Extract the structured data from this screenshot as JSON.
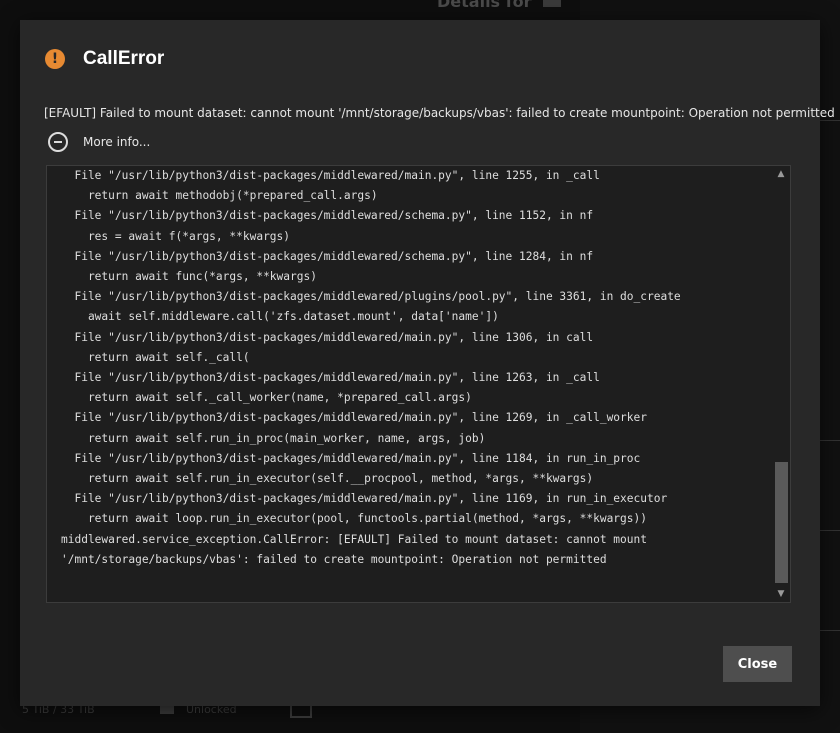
{
  "background": {
    "title": "Details for",
    "footer_size": "5 TiB / 33 TiB",
    "footer_status": "Unlocked"
  },
  "dialog": {
    "icon": "warning-circle-icon",
    "title": "CallError",
    "message": "[EFAULT] Failed to mount dataset: cannot mount '/mnt/storage/backups/vbas': failed to create mountpoint: Operation not permitted",
    "more_info_label": "More info...",
    "traceback": "  File \"/usr/lib/python3/dist-packages/middlewared/main.py\", line 1255, in _call\n    return await methodobj(*prepared_call.args)\n  File \"/usr/lib/python3/dist-packages/middlewared/schema.py\", line 1152, in nf\n    res = await f(*args, **kwargs)\n  File \"/usr/lib/python3/dist-packages/middlewared/schema.py\", line 1284, in nf\n    return await func(*args, **kwargs)\n  File \"/usr/lib/python3/dist-packages/middlewared/plugins/pool.py\", line 3361, in do_create\n    await self.middleware.call('zfs.dataset.mount', data['name'])\n  File \"/usr/lib/python3/dist-packages/middlewared/main.py\", line 1306, in call\n    return await self._call(\n  File \"/usr/lib/python3/dist-packages/middlewared/main.py\", line 1263, in _call\n    return await self._call_worker(name, *prepared_call.args)\n  File \"/usr/lib/python3/dist-packages/middlewared/main.py\", line 1269, in _call_worker\n    return await self.run_in_proc(main_worker, name, args, job)\n  File \"/usr/lib/python3/dist-packages/middlewared/main.py\", line 1184, in run_in_proc\n    return await self.run_in_executor(self.__procpool, method, *args, **kwargs)\n  File \"/usr/lib/python3/dist-packages/middlewared/main.py\", line 1169, in run_in_executor\n    return await loop.run_in_executor(pool, functools.partial(method, *args, **kwargs))\nmiddlewared.service_exception.CallError: [EFAULT] Failed to mount dataset: cannot mount\n'/mnt/storage/backups/vbas': failed to create mountpoint: Operation not permitted",
    "close_label": "Close",
    "colors": {
      "accent": "#e78a32",
      "dialog_bg": "#282828",
      "trace_bg": "#1e1e1e",
      "button_bg": "#4e4e4e"
    }
  }
}
